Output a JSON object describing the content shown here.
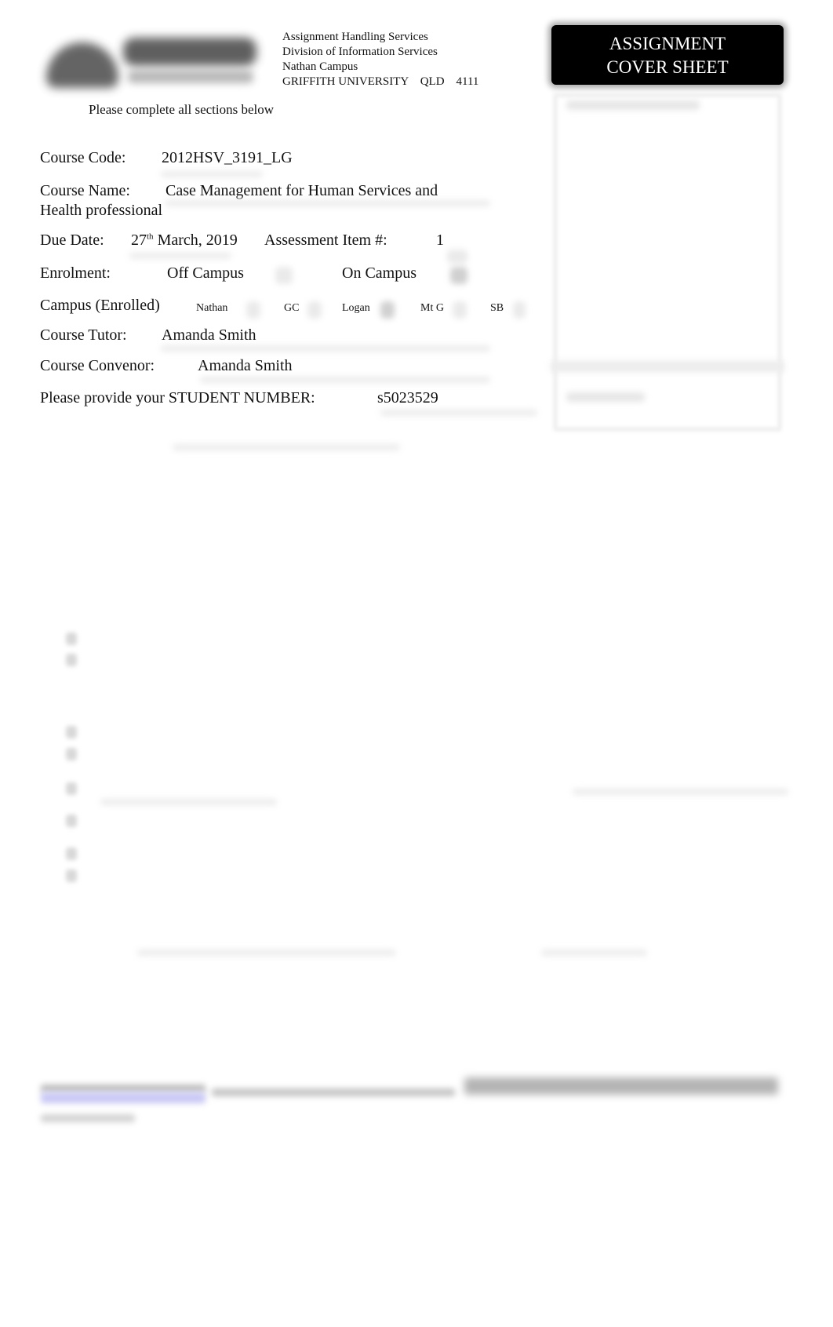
{
  "header": {
    "address_lines": [
      "Assignment Handling Services",
      "Division of Information Services",
      "Nathan Campus",
      "GRIFFITH UNIVERSITY    QLD    4111"
    ],
    "instruction": "Please complete all sections below",
    "title_line1": "ASSIGNMENT",
    "title_line2": "COVER SHEET"
  },
  "form": {
    "course_code": {
      "label": "Course Code:",
      "value": "2012HSV_3191_LG"
    },
    "course_name": {
      "label": "Course Name:",
      "value_line1": "Case Management for Human Services and",
      "value_line2": "Health professional"
    },
    "due_date": {
      "label": "Due Date:",
      "day": "27",
      "day_suffix": "th",
      "rest": "March, 2019"
    },
    "assessment_item": {
      "label": "Assessment Item #:",
      "value": "1"
    },
    "enrolment": {
      "label": "Enrolment:",
      "options": [
        {
          "label": "Off Campus",
          "checked": false
        },
        {
          "label": "On Campus",
          "checked": true
        }
      ]
    },
    "campus": {
      "label": "Campus (Enrolled)",
      "options": [
        {
          "label": "Nathan",
          "checked": false
        },
        {
          "label": "GC",
          "checked": false
        },
        {
          "label": "Logan",
          "checked": true
        },
        {
          "label": "Mt G",
          "checked": false
        },
        {
          "label": "SB",
          "checked": false
        }
      ]
    },
    "course_tutor": {
      "label": "Course Tutor:",
      "value": "Amanda Smith"
    },
    "course_convenor": {
      "label": "Course Convenor:",
      "value": "Amanda Smith"
    },
    "student_number": {
      "label": "Please provide your STUDENT NUMBER:",
      "value": "s5023529"
    }
  },
  "colors": {
    "title_bg": "#000000",
    "title_fg": "#ffffff",
    "link_blur": "#c9c8f5"
  }
}
